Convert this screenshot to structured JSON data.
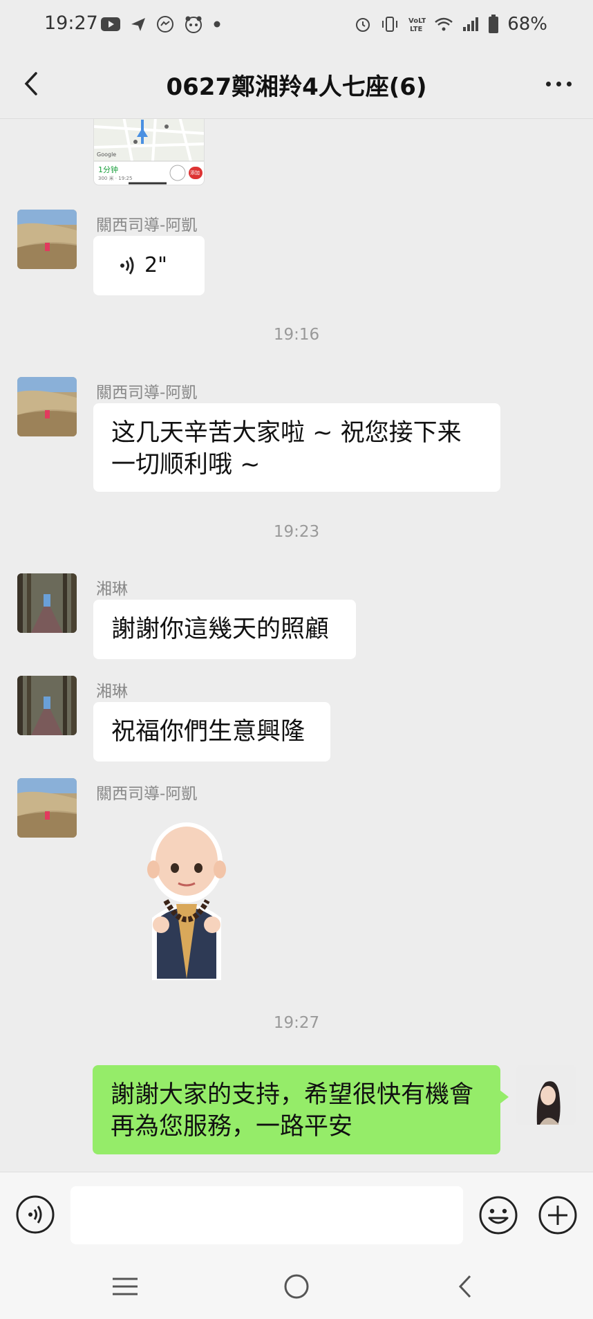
{
  "status_bar": {
    "time": "19:27",
    "left_icons": [
      "youtube-icon",
      "send-icon",
      "messenger-icon",
      "foodpanda-icon",
      "dot-icon"
    ],
    "right_icons": [
      "alarm-icon",
      "vibrate-icon",
      "volte-icon",
      "wifi-icon",
      "signal-icon",
      "battery-icon"
    ],
    "battery_percent": "68%"
  },
  "header": {
    "title": "0627鄭湘羚4人七座(6)",
    "back_icon": "chevron-left-icon",
    "more_icon": "more-dots-icon"
  },
  "messages": {
    "map": {
      "duration": "1分钟",
      "meta": "300 米 · 19:25",
      "brand": "Google",
      "btn": "添加"
    },
    "m1": {
      "sender": "關西司導-阿凱",
      "voice_duration": "2\""
    },
    "t1": "19:16",
    "m2": {
      "sender": "關西司導-阿凱",
      "line1": "这几天辛苦大家啦 ~ 祝您接下来",
      "line2": "一切顺利哦 ~"
    },
    "t2": "19:23",
    "m3": {
      "sender": "湘琳",
      "text": "謝謝你這幾天的照顧"
    },
    "m4": {
      "sender": "湘琳",
      "text": "祝福你們生意興隆"
    },
    "m5": {
      "sender": "關西司導-阿凱",
      "sticker": "monk-sticker"
    },
    "t3": "19:27",
    "m6": {
      "line1": "謝謝大家的支持，希望很快有機會",
      "line2": "再為您服務，一路平安"
    }
  },
  "input_bar": {
    "voice_icon": "voice-icon",
    "input_value": "",
    "emoji_icon": "smiley-icon",
    "plus_icon": "plus-icon"
  },
  "system_nav": [
    "recents-icon",
    "home-icon",
    "back-icon"
  ],
  "colors": {
    "background": "#ededed",
    "bubble_self": "#95ec69",
    "bubble_other": "#ffffff"
  }
}
